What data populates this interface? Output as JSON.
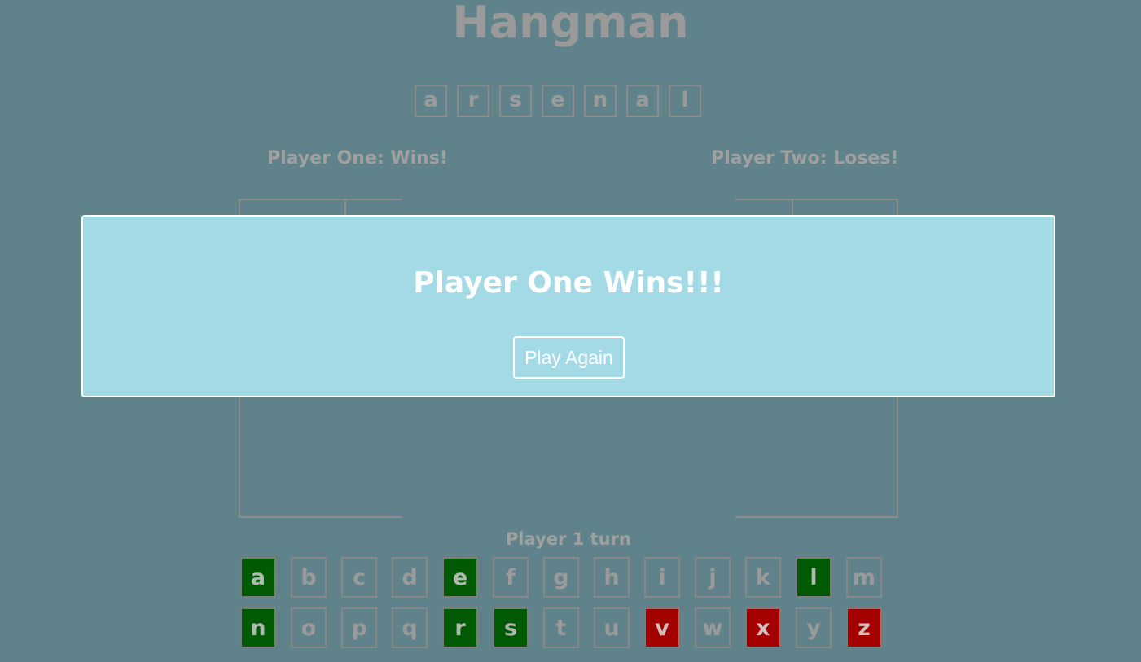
{
  "header": {
    "title": "Hangman"
  },
  "word": [
    "a",
    "r",
    "s",
    "e",
    "n",
    "a",
    "l"
  ],
  "players": {
    "one_status": "Player One: Wins!",
    "two_status": "Player Two: Loses!"
  },
  "turn_text": "Player 1 turn",
  "keyboard": {
    "keys": [
      {
        "letter": "a",
        "state": "correct"
      },
      {
        "letter": "b",
        "state": "unused"
      },
      {
        "letter": "c",
        "state": "unused"
      },
      {
        "letter": "d",
        "state": "unused"
      },
      {
        "letter": "e",
        "state": "correct"
      },
      {
        "letter": "f",
        "state": "unused"
      },
      {
        "letter": "g",
        "state": "unused"
      },
      {
        "letter": "h",
        "state": "unused"
      },
      {
        "letter": "i",
        "state": "unused"
      },
      {
        "letter": "j",
        "state": "unused"
      },
      {
        "letter": "k",
        "state": "unused"
      },
      {
        "letter": "l",
        "state": "correct"
      },
      {
        "letter": "m",
        "state": "unused"
      },
      {
        "letter": "n",
        "state": "correct"
      },
      {
        "letter": "o",
        "state": "unused"
      },
      {
        "letter": "p",
        "state": "unused"
      },
      {
        "letter": "q",
        "state": "unused"
      },
      {
        "letter": "r",
        "state": "correct"
      },
      {
        "letter": "s",
        "state": "correct"
      },
      {
        "letter": "t",
        "state": "unused"
      },
      {
        "letter": "u",
        "state": "unused"
      },
      {
        "letter": "v",
        "state": "wrong"
      },
      {
        "letter": "w",
        "state": "unused"
      },
      {
        "letter": "x",
        "state": "wrong"
      },
      {
        "letter": "y",
        "state": "unused"
      },
      {
        "letter": "z",
        "state": "wrong"
      }
    ]
  },
  "modal": {
    "title": "Player One Wins!!!",
    "button_label": "Play Again"
  },
  "colors": {
    "background": "#60828a",
    "modal_background": "#a3dae6",
    "correct": "#005a04",
    "wrong": "#a30000"
  }
}
